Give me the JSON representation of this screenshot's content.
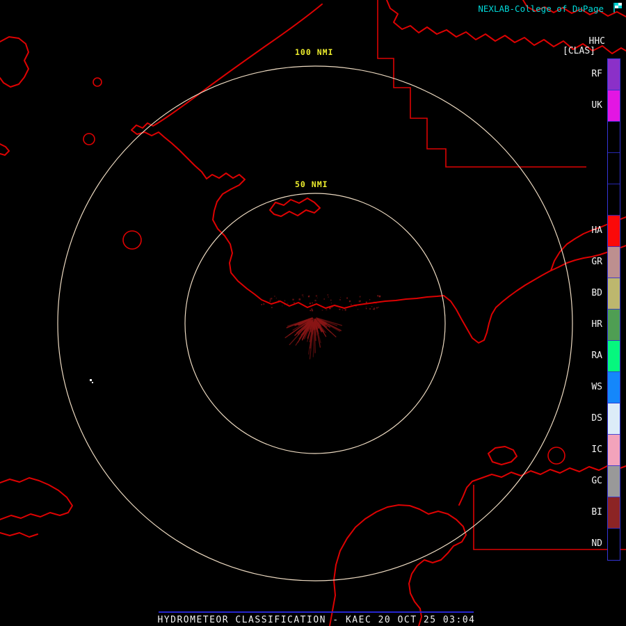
{
  "header": {
    "brand": "NEXLAB-College of DuPage",
    "product_code": "HHC",
    "product_tag": "[CLAS]"
  },
  "range_rings": {
    "outer_label": "100 NMI",
    "inner_label": "50 NMI"
  },
  "legend": {
    "segments": [
      {
        "label": "RF",
        "color": "#8b30c8"
      },
      {
        "label": "UK",
        "color": "#e316e3"
      },
      {
        "label": "",
        "color": "#000000"
      },
      {
        "label": "",
        "color": "#000000"
      },
      {
        "label": "",
        "color": "#000000"
      },
      {
        "label": "HA",
        "color": "#fb0909"
      },
      {
        "label": "GR",
        "color": "#bd8f8f"
      },
      {
        "label": "BD",
        "color": "#bdb76e"
      },
      {
        "label": "HR",
        "color": "#4f9e53"
      },
      {
        "label": "RA",
        "color": "#06f77e"
      },
      {
        "label": "WS",
        "color": "#1487fb"
      },
      {
        "label": "DS",
        "color": "#dcecf8"
      },
      {
        "label": "IC",
        "color": "#f2a3bb"
      },
      {
        "label": "GC",
        "color": "#999999"
      },
      {
        "label": "BI",
        "color": "#8c2424"
      },
      {
        "label": "ND",
        "color": "#000000"
      }
    ]
  },
  "footer": {
    "title": "HYDROMETEOR CLASSIFICATION - KAEC 20 OCT 25 03:04"
  },
  "colors": {
    "map_line": "#dd0202",
    "ring": "#efdcc3",
    "ring_label": "#ecec2d",
    "brand": "#00d8d8",
    "white": "#f2f2f2",
    "echo": "#8a1616",
    "divider": "#2626cf"
  }
}
